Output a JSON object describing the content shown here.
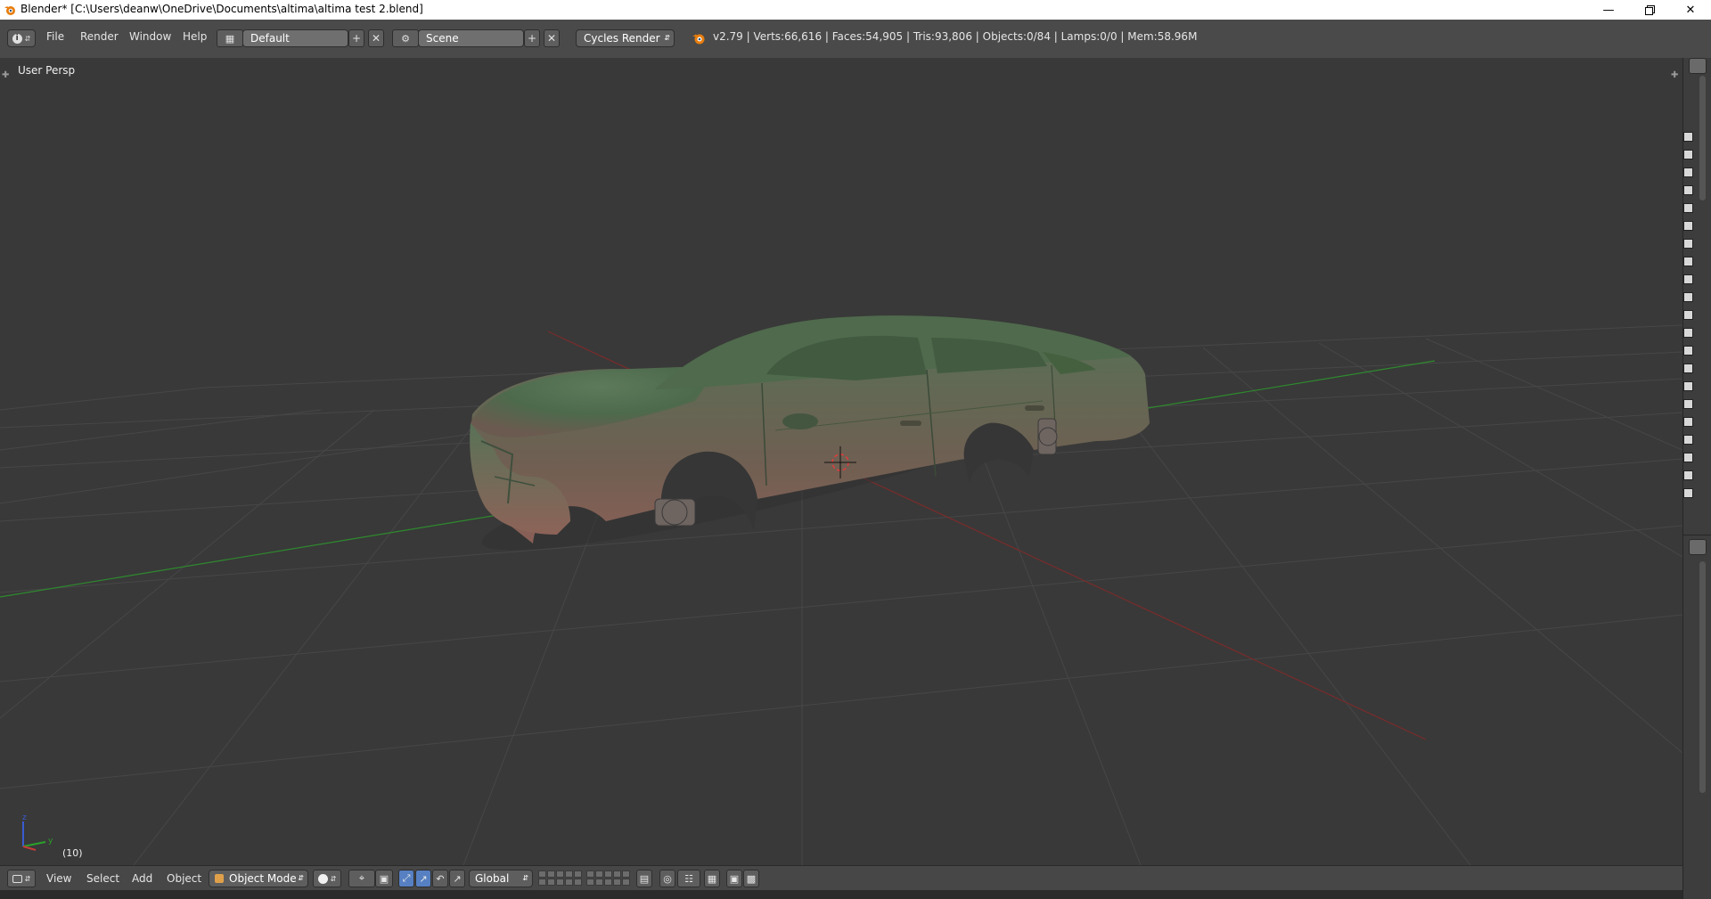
{
  "window": {
    "title": "Blender* [C:\\Users\\deanw\\OneDrive\\Documents\\altima\\altima test 2.blend]",
    "minimize_icon": "minimize-icon",
    "maximize_icon": "restore-icon",
    "close_icon": "close-icon"
  },
  "info_header": {
    "editor_type_icon": "info-icon",
    "menus": [
      "File",
      "Render",
      "Window",
      "Help"
    ],
    "screen_layout": "Default",
    "scene": "Scene",
    "render_engine": "Cycles Render",
    "stats": "v2.79 | Verts:66,616 | Faces:54,905 | Tris:93,806 | Objects:0/84 | Lamps:0/0 | Mem:58.96M"
  },
  "viewport": {
    "view_label": "User Persp",
    "frame_label": "(10)",
    "axis_labels": {
      "x": "x",
      "y": "y",
      "z": "z"
    },
    "colors": {
      "background": "#393939",
      "grid": "#484848",
      "x_axis": "#8a2a2a",
      "y_axis": "#2d8a2d",
      "car_green": "#52684f",
      "car_red": "#7d5a50"
    }
  },
  "view3d_header": {
    "editor_type_icon": "view3d-icon",
    "menus": [
      "View",
      "Select",
      "Add",
      "Object"
    ],
    "mode": "Object Mode",
    "transform_orientation": "Global",
    "pivot_icon": "pivot-point-icon",
    "shading_icon": "viewport-shading-icon"
  },
  "accent_color": "#5680c2"
}
